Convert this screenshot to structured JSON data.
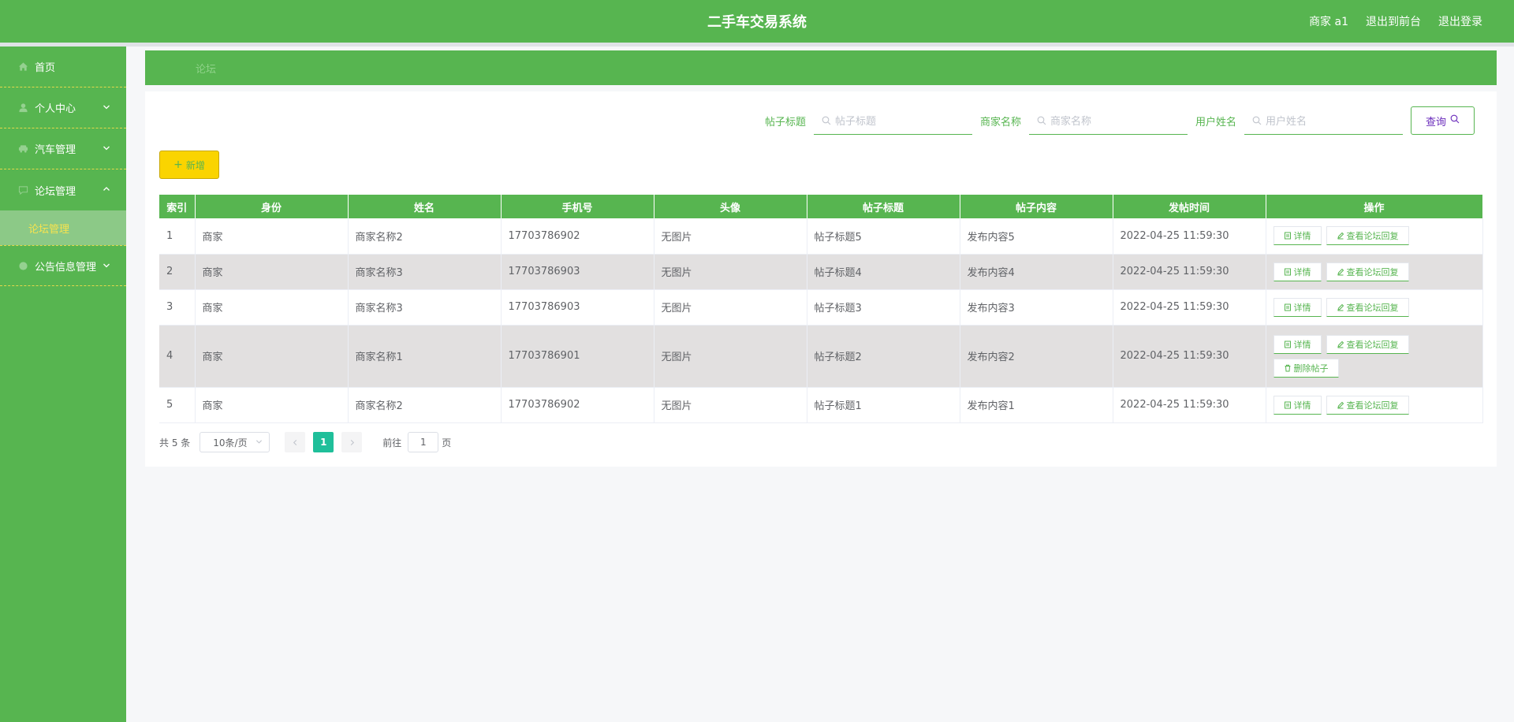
{
  "header": {
    "title": "二手车交易系统",
    "user_label": "商家 a1",
    "front_label": "退出到前台",
    "logout_label": "退出登录"
  },
  "sidebar": {
    "items": [
      {
        "label": "首页",
        "icon": "home-icon"
      },
      {
        "label": "个人中心",
        "icon": "user-icon",
        "expanded": false
      },
      {
        "label": "汽车管理",
        "icon": "car-icon",
        "expanded": false
      },
      {
        "label": "论坛管理",
        "icon": "forum-icon",
        "expanded": true,
        "children": [
          {
            "label": "论坛管理",
            "active": true
          }
        ]
      },
      {
        "label": "公告信息管理",
        "icon": "notice-icon",
        "expanded": false
      }
    ]
  },
  "breadcrumb": {
    "current": "论坛"
  },
  "search": {
    "fields": [
      {
        "label": "帖子标题",
        "placeholder": "帖子标题"
      },
      {
        "label": "商家名称",
        "placeholder": "商家名称"
      },
      {
        "label": "用户姓名",
        "placeholder": "用户姓名"
      }
    ],
    "button_label": "查询"
  },
  "toolbar": {
    "add_label": "新增"
  },
  "table": {
    "columns": [
      "索引",
      "身份",
      "姓名",
      "手机号",
      "头像",
      "帖子标题",
      "帖子内容",
      "发帖时间",
      "操作"
    ],
    "rows": [
      {
        "index": "1",
        "role": "商家",
        "name": "商家名称2",
        "phone": "17703786902",
        "avatar": "无图片",
        "title": "帖子标题5",
        "content": "发布内容5",
        "time": "2022-04-25 11:59:30",
        "can_delete": false
      },
      {
        "index": "2",
        "role": "商家",
        "name": "商家名称3",
        "phone": "17703786903",
        "avatar": "无图片",
        "title": "帖子标题4",
        "content": "发布内容4",
        "time": "2022-04-25 11:59:30",
        "can_delete": false
      },
      {
        "index": "3",
        "role": "商家",
        "name": "商家名称3",
        "phone": "17703786903",
        "avatar": "无图片",
        "title": "帖子标题3",
        "content": "发布内容3",
        "time": "2022-04-25 11:59:30",
        "can_delete": false
      },
      {
        "index": "4",
        "role": "商家",
        "name": "商家名称1",
        "phone": "17703786901",
        "avatar": "无图片",
        "title": "帖子标题2",
        "content": "发布内容2",
        "time": "2022-04-25 11:59:30",
        "can_delete": true
      },
      {
        "index": "5",
        "role": "商家",
        "name": "商家名称2",
        "phone": "17703786902",
        "avatar": "无图片",
        "title": "帖子标题1",
        "content": "发布内容1",
        "time": "2022-04-25 11:59:30",
        "can_delete": false
      }
    ],
    "ops": {
      "detail": "详情",
      "reply": "查看论坛回复",
      "delete": "删除帖子"
    }
  },
  "pagination": {
    "total_text": "共 5 条",
    "page_size": "10条/页",
    "current_page": "1",
    "goto_prefix": "前往",
    "goto_value": "1",
    "goto_suffix": "页"
  },
  "colors": {
    "primary": "#57b550",
    "accent": "#fad400",
    "active_page": "#1fbf9a"
  }
}
